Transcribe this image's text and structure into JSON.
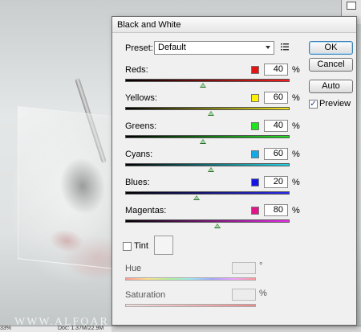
{
  "background": {
    "watermark": "WWW.ALFOAR",
    "status_zoom": "33%",
    "status_doc": "Doc: 1.37M/22.9M"
  },
  "dialog": {
    "title": "Black and White",
    "preset": {
      "label": "Preset:",
      "value": "Default",
      "menu_icon": "list-menu-icon"
    },
    "buttons": {
      "ok": "OK",
      "cancel": "Cancel",
      "auto": "Auto"
    },
    "preview": {
      "label": "Preview",
      "checked": true,
      "checkmark": "✓"
    },
    "sliders": [
      {
        "label": "Reds:",
        "value": "40",
        "unit": "%",
        "swatch": "#e31414",
        "track": "linear-gradient(90deg,#000,#ff1b1b)",
        "level": 0.475
      },
      {
        "label": "Yellows:",
        "value": "60",
        "unit": "%",
        "swatch": "#ffef00",
        "track": "linear-gradient(90deg,#000,#f3ea20)",
        "level": 0.52
      },
      {
        "label": "Greens:",
        "value": "40",
        "unit": "%",
        "swatch": "#1ee41e",
        "track": "linear-gradient(90deg,#000,#22e022)",
        "level": 0.475
      },
      {
        "label": "Cyans:",
        "value": "60",
        "unit": "%",
        "swatch": "#15a9e6",
        "track": "linear-gradient(90deg,#000,#22d8e8)",
        "level": 0.52
      },
      {
        "label": "Blues:",
        "value": "20",
        "unit": "%",
        "swatch": "#1414e6",
        "track": "linear-gradient(90deg,#000,#2a2aee)",
        "level": 0.435
      },
      {
        "label": "Magentas:",
        "value": "80",
        "unit": "%",
        "swatch": "#e0158a",
        "track": "linear-gradient(90deg,#000,#ec2cec)",
        "level": 0.56
      }
    ],
    "tint": {
      "label": "Tint",
      "checked": false
    },
    "hue": {
      "label": "Hue",
      "unit": "°"
    },
    "saturation": {
      "label": "Saturation",
      "unit": "%"
    }
  }
}
